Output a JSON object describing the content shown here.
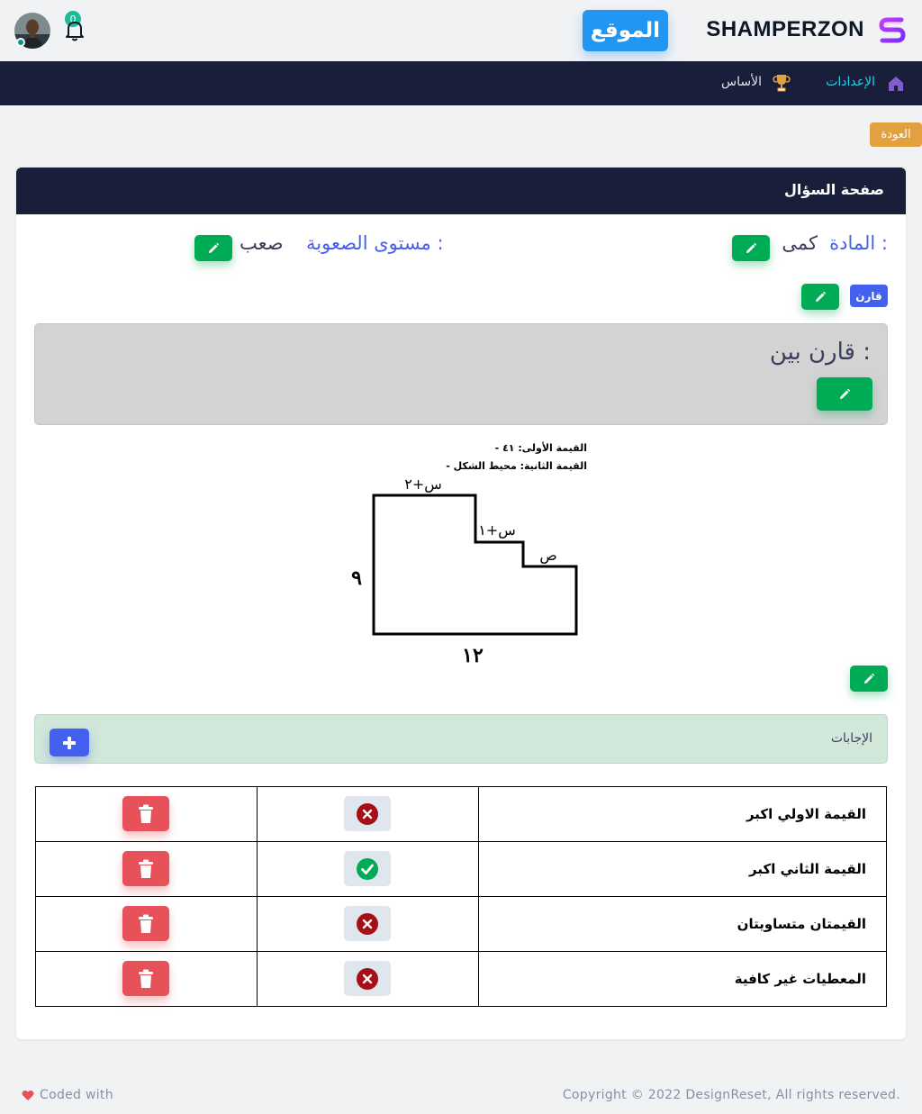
{
  "header": {
    "brand_name": "SHAMPERZON",
    "site_button": "الموقع",
    "notifications_count": "0"
  },
  "nav": {
    "settings": "الإعدادات",
    "base": "الأساس"
  },
  "back_button": "العودة",
  "card": {
    "title": "صفحة السؤال",
    "subject_label": "المادة :",
    "subject_value": "كمى",
    "difficulty_label": "مستوى الصعوبة :",
    "difficulty_value": "صعب",
    "question_type": "قارن",
    "question_text": "قارن بين :"
  },
  "figure": {
    "line1": "- القيمة الأولى: ٤١",
    "line2": "- القيمة الثانية: محيط الشكل",
    "label_top": "س+٢",
    "label_step1": "س+١",
    "label_step2": "ص",
    "label_left": "٩",
    "label_bottom": "١٢"
  },
  "answers": {
    "title": "الإجابات",
    "rows": [
      {
        "text": "القيمة الاولي اكبر",
        "correct": false
      },
      {
        "text": "القيمة الثاني اكبر",
        "correct": true
      },
      {
        "text": "القيمتان متساويتان",
        "correct": false
      },
      {
        "text": "المعطيات غير كافية",
        "correct": false
      }
    ]
  },
  "footer": {
    "copyright": "Copyright © 2022 DesignReset, All rights reserved.",
    "coded_with": "Coded with"
  },
  "colors": {
    "primary": "#4361ee",
    "success": "#00ab55",
    "danger": "#e7515a",
    "warning": "#e2a03f",
    "dark": "#191e3a",
    "info": "#2196f3"
  }
}
